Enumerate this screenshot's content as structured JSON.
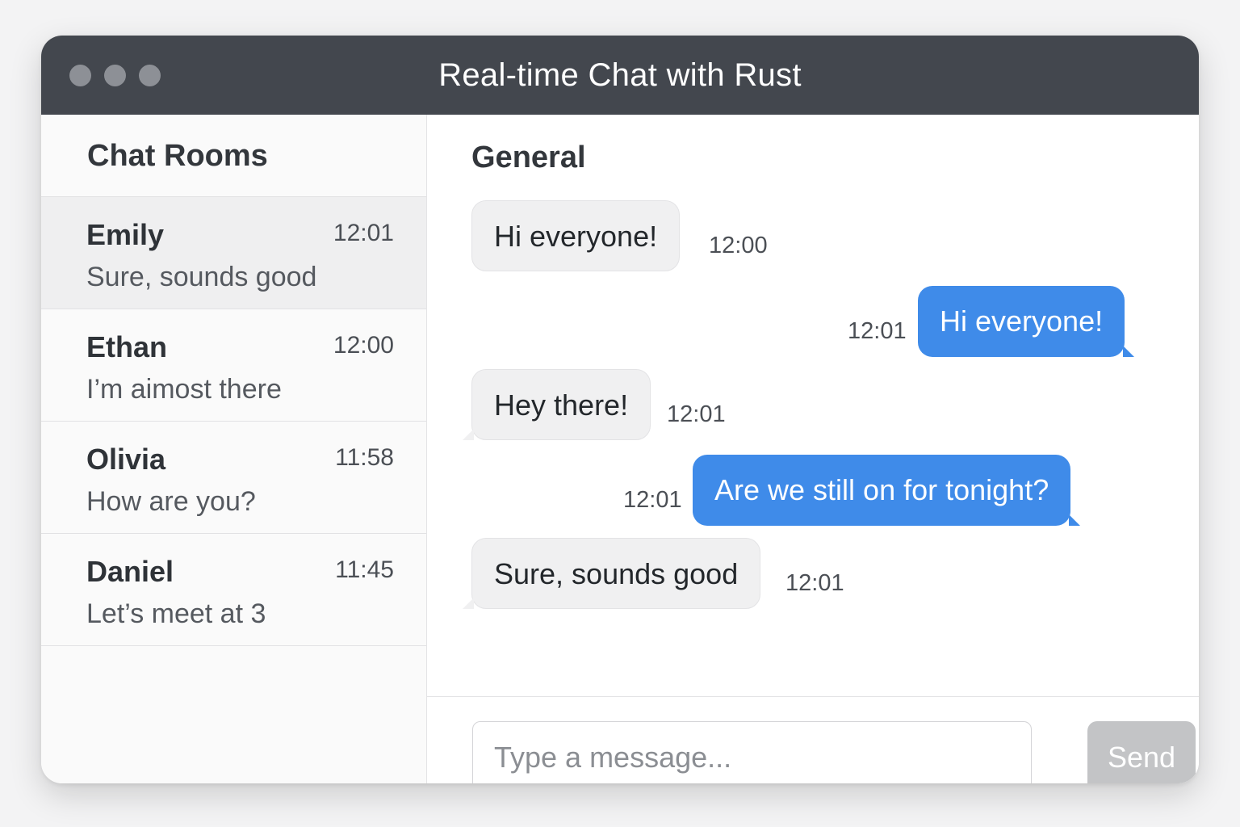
{
  "window": {
    "title": "Real-time Chat with Rust"
  },
  "sidebar": {
    "heading": "Chat Rooms",
    "rooms": [
      {
        "name": "Emily",
        "time": "12:01",
        "preview": "Sure, sounds good",
        "active": true
      },
      {
        "name": "Ethan",
        "time": "12:00",
        "preview": "I’m aimost there",
        "active": false
      },
      {
        "name": "Olivia",
        "time": "11:58",
        "preview": "How are you?",
        "active": false
      },
      {
        "name": "Daniel",
        "time": "11:45",
        "preview": "Let’s meet at 3",
        "active": false
      }
    ]
  },
  "chat": {
    "room_title": "General",
    "messages": [
      {
        "text": "Hi everyone!",
        "time": "12:00",
        "direction": "incoming"
      },
      {
        "text": "Hi everyone!",
        "time": "12:01",
        "direction": "outgoing"
      },
      {
        "text": "Hey there!",
        "time": "12:01",
        "direction": "incoming"
      },
      {
        "text": "Are we still on for tonight?",
        "time": "12:01",
        "direction": "outgoing"
      },
      {
        "text": "Sure, sounds good",
        "time": "12:01",
        "direction": "incoming"
      }
    ]
  },
  "composer": {
    "placeholder": "Type a message...",
    "value": "",
    "send_label": "Send"
  },
  "colors": {
    "titlebar": "#43474e",
    "outgoing_bubble": "#3f8be9",
    "incoming_bubble": "#f0f0f1",
    "send_disabled": "#c3c4c6"
  }
}
